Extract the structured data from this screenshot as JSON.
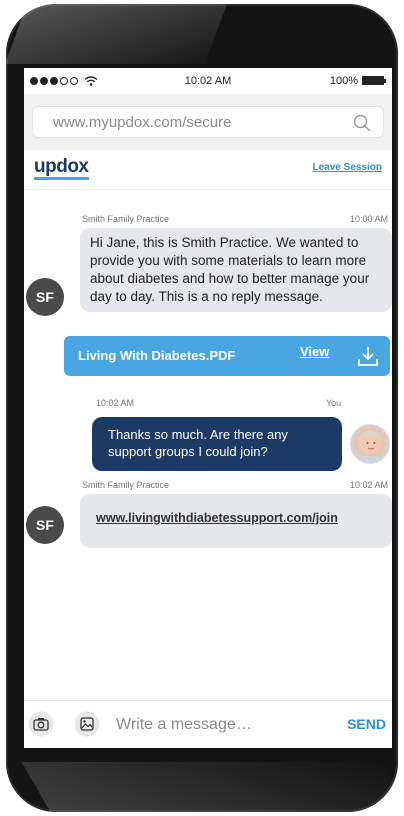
{
  "status_bar": {
    "time": "10:02 AM",
    "battery": "100%",
    "signal_icon": "signal-dots-icon",
    "wifi_icon": "wifi-icon"
  },
  "browser": {
    "url": "www.myupdox.com/secure"
  },
  "header": {
    "logo": "updox",
    "leave_session": "Leave Session"
  },
  "messages": [
    {
      "sender": "Smith Family Practice",
      "time": "10:00 AM",
      "avatar": "SF",
      "text": "Hi Jane, this is Smith Practice. We wanted to provide you with some materials to learn more about diabetes and how to better manage your day to day. This is a no reply message."
    },
    {
      "attachment": "Living With Diabetes.PDF",
      "view_label": "View"
    },
    {
      "sender": "You",
      "time": "10:02 AM",
      "text": "Thanks so much. Are there any support groups I could join?"
    },
    {
      "sender": "Smith Family Practice",
      "time": "10:02 AM",
      "avatar": "SF",
      "link": "www.livingwithdiabetessupport.com/join"
    }
  ],
  "compose": {
    "placeholder": "Write a message…",
    "send_label": "SEND"
  },
  "colors": {
    "brand_blue": "#4aa6e0",
    "navy": "#1b3a66",
    "link": "#2f8fd8"
  }
}
